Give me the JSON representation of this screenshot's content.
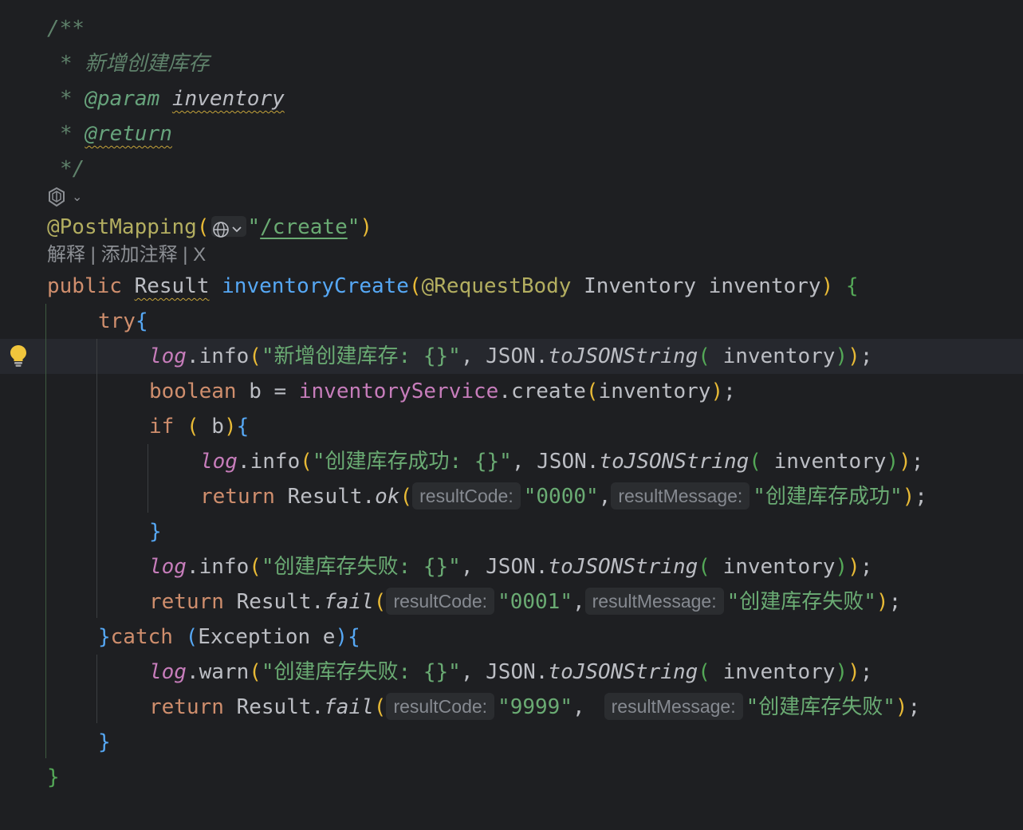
{
  "editor": {
    "doc": {
      "open": "/**",
      "star": "*",
      "summary": "新增创建库存",
      "param_tag": "@param",
      "param_name": "inventory",
      "return_tag": "@return",
      "close": "*/"
    },
    "ai_icon": "ai-assistant-icon",
    "annotation": "@PostMapping",
    "mapping_path": "/create",
    "codelens": {
      "explain": "解释",
      "separator": "|",
      "add_comment": "添加注释",
      "close": "X"
    },
    "signature": {
      "modifier": "public",
      "return_type": "Result",
      "method_name": "inventoryCreate",
      "param_annotation": "@RequestBody",
      "param_type": "Inventory",
      "param_name": "inventory"
    },
    "try_kw": "try",
    "log_var": "log",
    "json_class": "JSON",
    "to_json_method": "toJSONString",
    "log_info": "info",
    "log_warn": "warn",
    "msg_create": "\"新增创建库存: {}\"",
    "msg_success": "\"创建库存成功: {}\"",
    "msg_fail": "\"创建库存失败: {}\"",
    "bool_type": "boolean",
    "var_b": "b",
    "service_field": "inventoryService",
    "create_method": "create",
    "if_kw": "if",
    "return_kw": "return",
    "result_class": "Result",
    "ok_method": "ok",
    "fail_method": "fail",
    "hint_code": "resultCode:",
    "hint_message": "resultMessage:",
    "code_ok": "\"0000\"",
    "msg_ok_text": "\"创建库存成功\"",
    "code_fail": "\"0001\"",
    "msg_fail_text": "\"创建库存失败\"",
    "catch_kw": "catch",
    "exception_type": "Exception",
    "exception_var": "e",
    "code_error": "\"9999\"",
    "bulb_icon": "lightbulb-icon"
  }
}
